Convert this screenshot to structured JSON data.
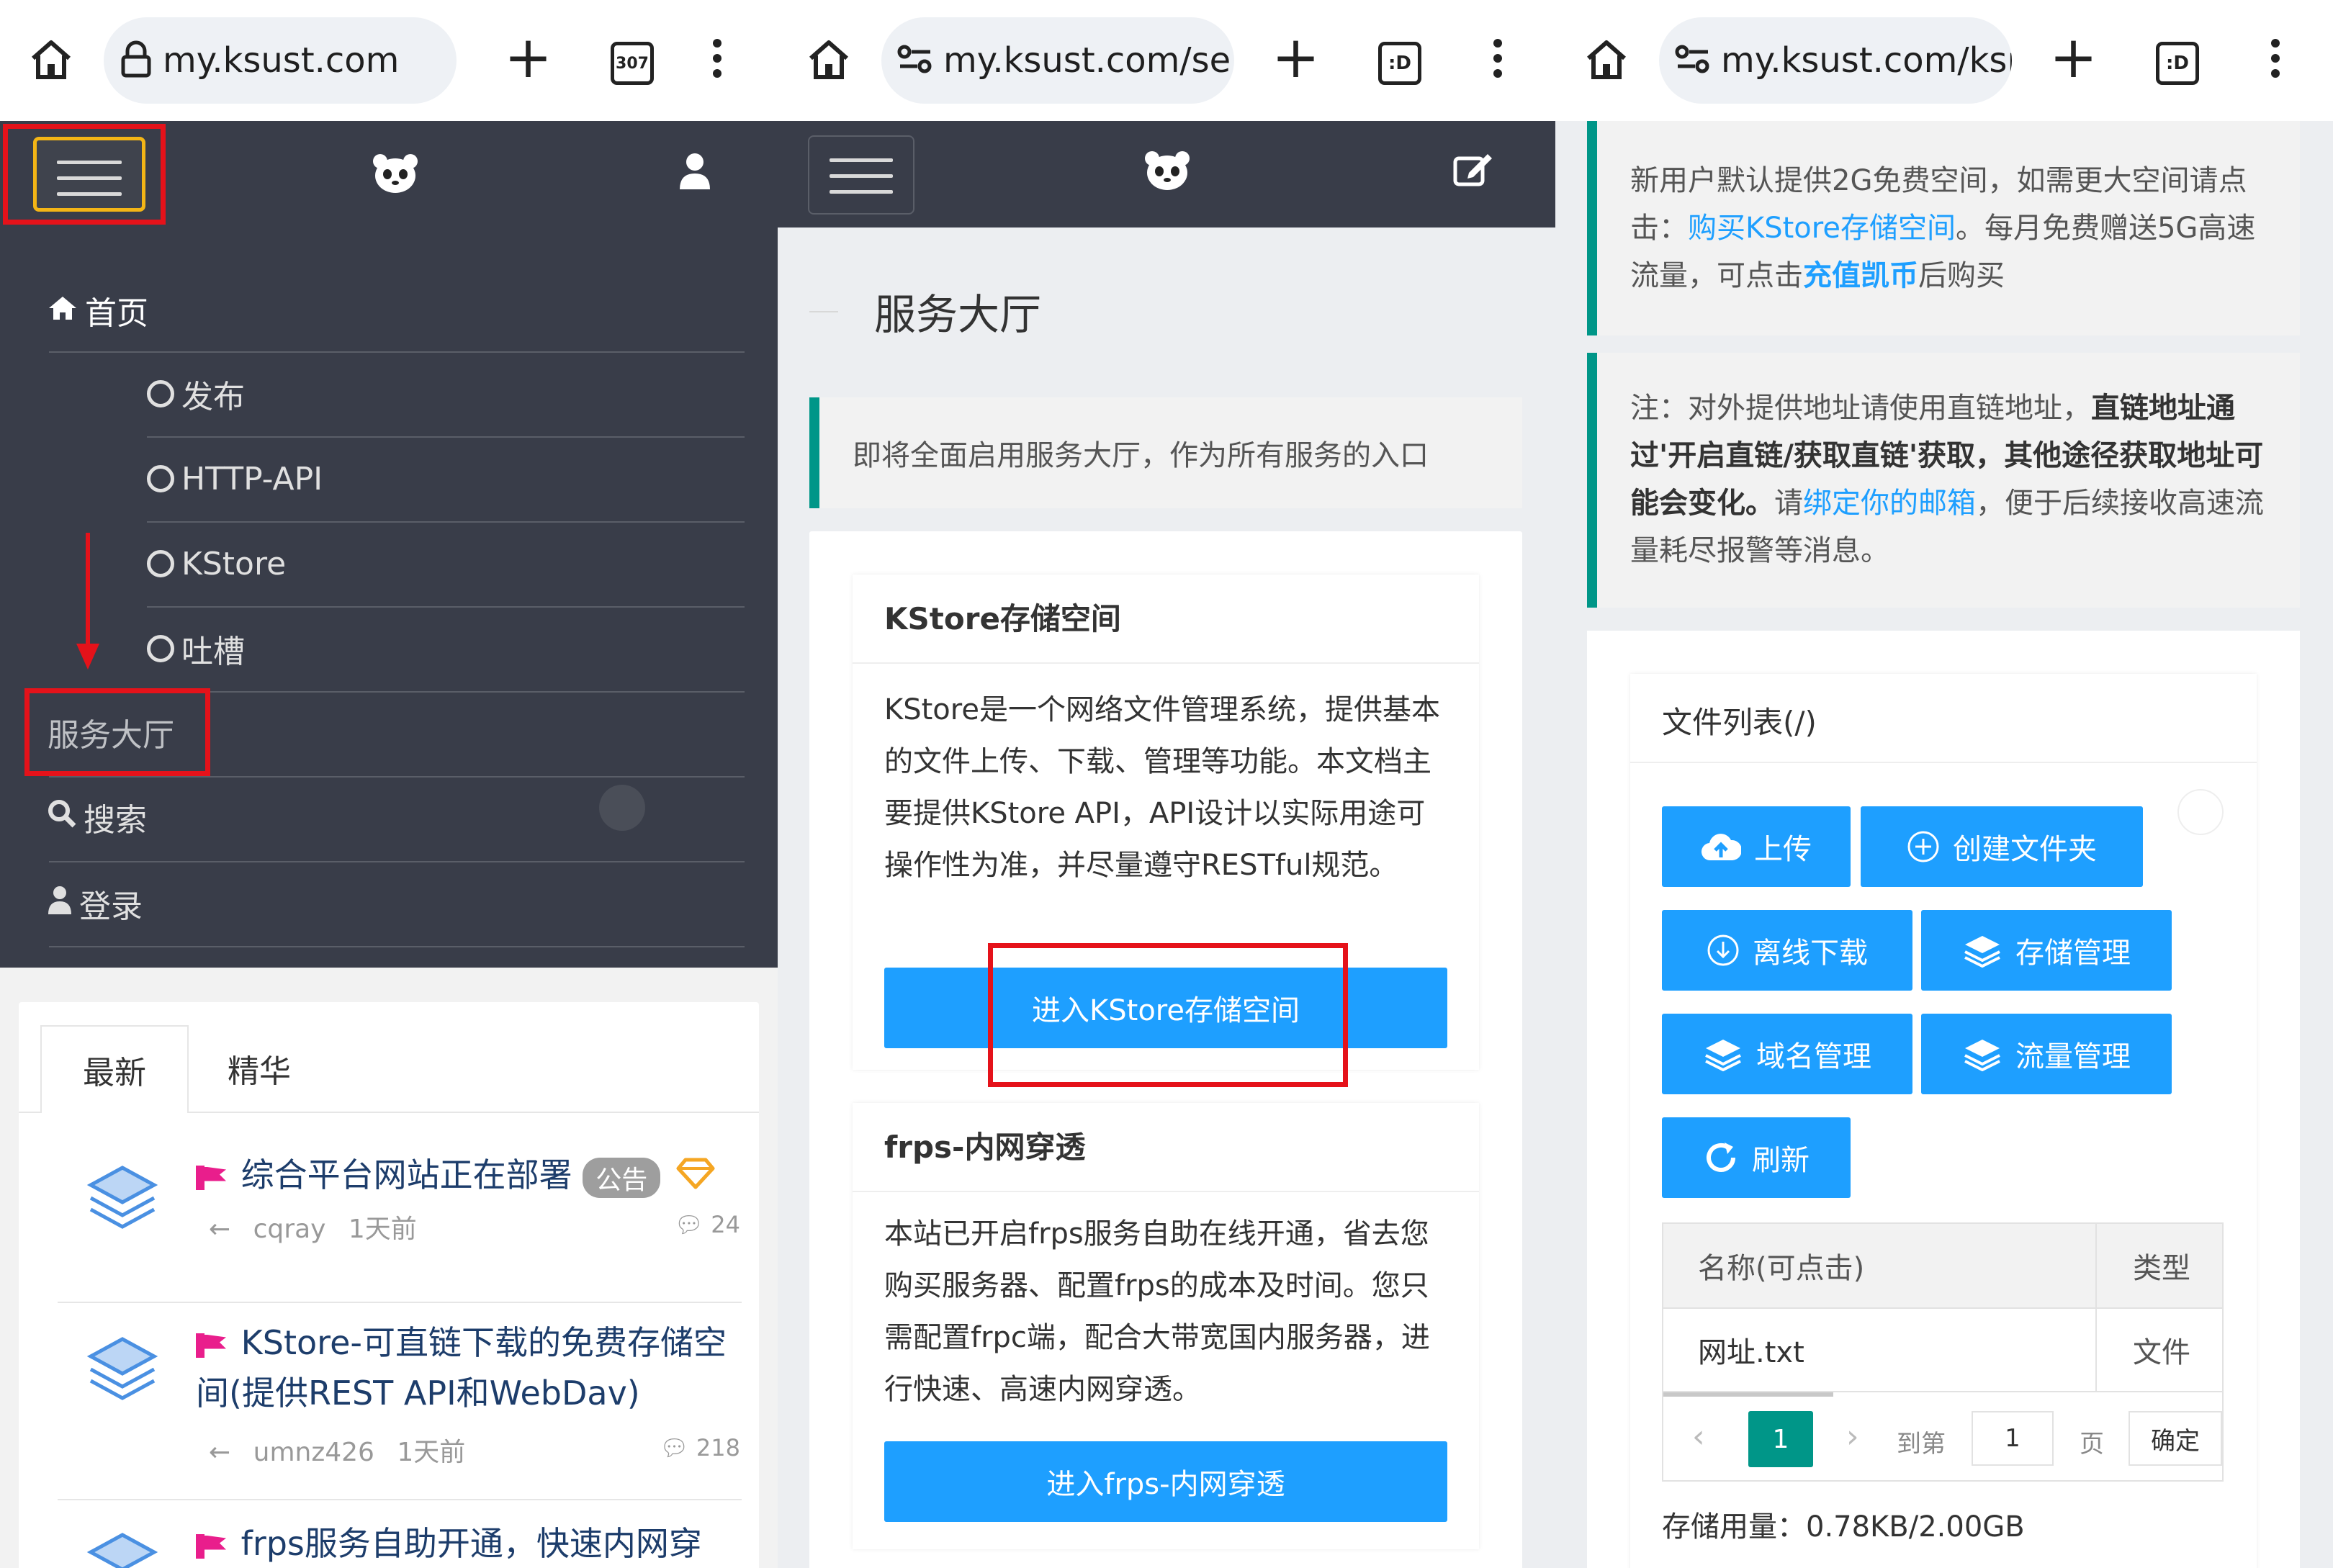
{
  "panel1": {
    "url": "my.ksust.com",
    "tab_count": "307",
    "menu": {
      "home": "首页",
      "sub_items": [
        "发布",
        "HTTP-API",
        "KStore",
        "吐槽"
      ],
      "service_hall": "服务大厅",
      "search": "搜索",
      "login": "登录"
    },
    "tabs": [
      "最新",
      "精华"
    ],
    "posts": [
      {
        "title": "综合平台网站正在部署",
        "tag": "公告",
        "author": "cqray",
        "time": "1天前",
        "comments": "24"
      },
      {
        "title": "KStore-可直链下载的免费存储空间(提供REST API和WebDav)",
        "author": "umnz426",
        "time": "1天前",
        "comments": "218"
      },
      {
        "title": "frps服务自助开通，快速内网穿"
      }
    ]
  },
  "panel2": {
    "url": "my.ksust.com/se",
    "tab_badge": ":D",
    "page_title": "服务大厅",
    "notice": "即将全面启用服务大厅，作为所有服务的入口",
    "cards": [
      {
        "title": "KStore存储空间",
        "body": "KStore是一个网络文件管理系统，提供基本的文件上传、下载、管理等功能。本文档主要提供KStore API，API设计以实际用途可操作性为准，并尽量遵守RESTful规范。",
        "button": "进入KStore存储空间"
      },
      {
        "title": "frps-内网穿透",
        "body": "本站已开启frps服务自助在线开通，省去您购买服务器、配置frps的成本及时间。您只需配置frpc端，配合大带宽国内服务器，进行快速、高速内网穿透。",
        "button": "进入frps-内网穿透"
      }
    ]
  },
  "panel3": {
    "url": "my.ksust.com/ksı",
    "tab_badge": ":D",
    "note1": {
      "t1": "新用户默认提供2G免费空间，如需更大空间请点击：",
      "link1": "购买KStore存储空间",
      "t2": "。每月免费赠送5G高速流量，可点击",
      "link2": "充值凯币",
      "t3": "后购买"
    },
    "note2": {
      "t1": "注：对外提供地址请使用直链地址，",
      "bold": "直链地址通过'开启直链/获取直链'获取，其他途径获取地址可能会变化。",
      "t2": "请",
      "link": "绑定你的邮箱",
      "t3": "，便于后续接收高速流量耗尽报警等消息。"
    },
    "file_list_title": "文件列表(/)",
    "buttons": {
      "upload": "上传",
      "new_folder": "创建文件夹",
      "offline_download": "离线下载",
      "storage_manage": "存储管理",
      "domain_manage": "域名管理",
      "traffic_manage": "流量管理",
      "refresh": "刷新"
    },
    "table": {
      "headers": [
        "名称(可点击)",
        "类型"
      ],
      "rows": [
        [
          "网址.txt",
          "文件"
        ]
      ]
    },
    "pager": {
      "current": "1",
      "goto_label": "到第",
      "goto_value": "1",
      "page_label": "页",
      "confirm": "确定"
    },
    "storage_usage": "存储用量：0.78KB/2.00GB"
  }
}
